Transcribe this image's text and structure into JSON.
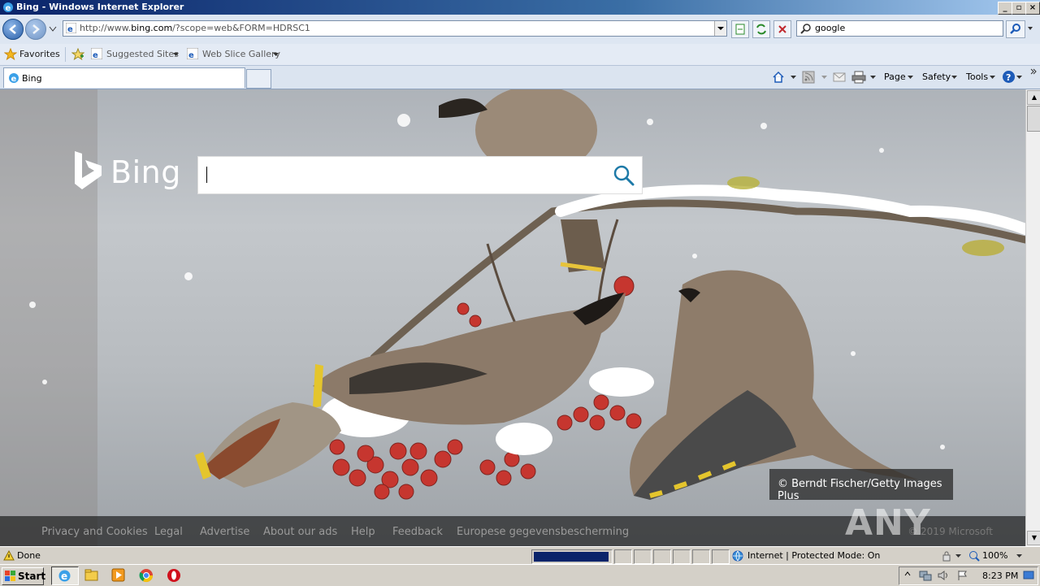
{
  "window": {
    "title": "Bing - Windows Internet Explorer"
  },
  "address": {
    "url_prefix": "http://www.",
    "url_domain": "bing.com",
    "url_rest": "/?scope=web&FORM=HDRSC1"
  },
  "search": {
    "query": "google"
  },
  "favorites_bar": {
    "favorites_label": "Favorites",
    "suggested_label": "Suggested Sites",
    "webslice_label": "Web Slice Gallery"
  },
  "tab": {
    "title": "Bing"
  },
  "commandbar": {
    "page": "Page",
    "safety": "Safety",
    "tools": "Tools"
  },
  "bing": {
    "logo_text": "Bing",
    "search_value": "",
    "copyright": "© Berndt Fischer/Getty Images Plus",
    "footer_links": [
      "Privacy and Cookies",
      "Legal",
      "Advertise",
      "About our ads",
      "Help",
      "Feedback",
      "Europese gegevensbescherming"
    ],
    "footer_right": "© 2019 Microsoft"
  },
  "watermark": "ANY RUN",
  "statusbar": {
    "status": "Done",
    "zone": "Internet | Protected Mode: On",
    "zoom": "100%"
  },
  "taskbar": {
    "start": "Start",
    "clock": "8:23 PM"
  },
  "colors": {
    "ie_blue": "#1d5bb8",
    "bing_search_icon": "#1e7aa8",
    "footer_bg": "#141414"
  }
}
